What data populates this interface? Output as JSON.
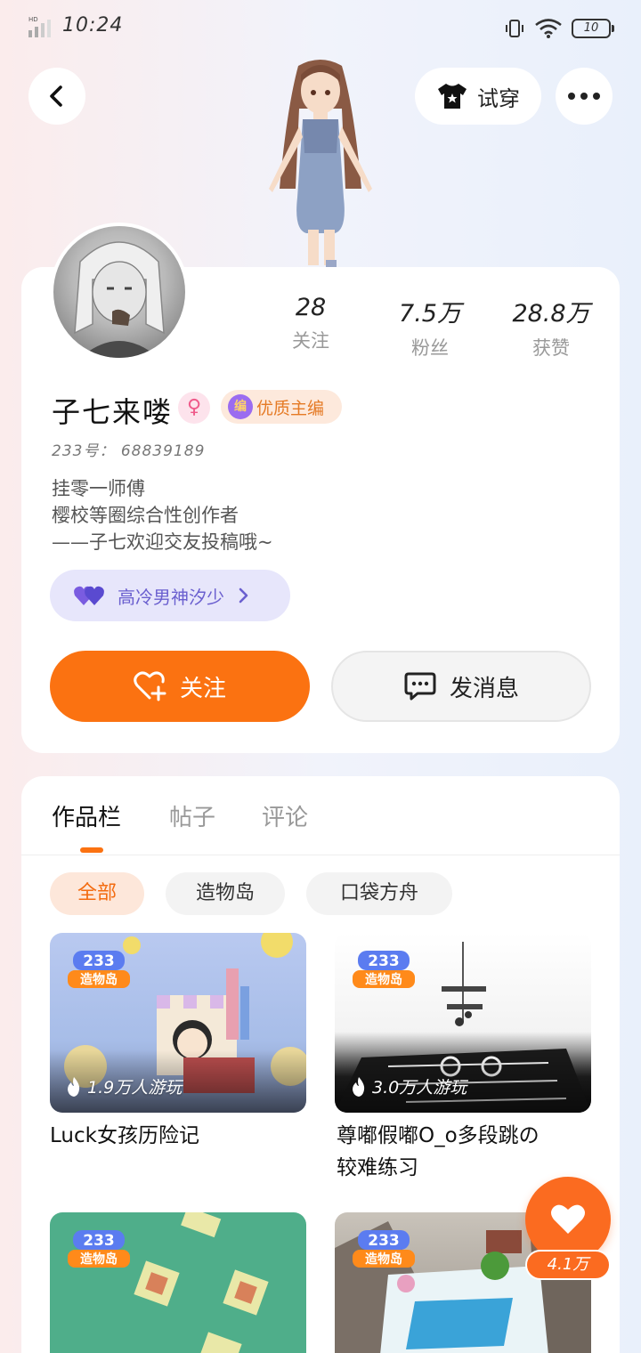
{
  "status_bar": {
    "time": "10:24",
    "battery": "10"
  },
  "top": {
    "tryon_label": "试穿"
  },
  "profile": {
    "name": "子七来喽",
    "editor_badge": "优质主编",
    "editor_badge_icon_text": "编",
    "uid": "233号： 68839189",
    "bio": [
      "挂零一师傅",
      "樱校等圈综合性创作者",
      "——子七欢迎交友投稿哦~"
    ],
    "stats": [
      {
        "num": "28",
        "label": "关注"
      },
      {
        "num": "7.5万",
        "label": "粉丝"
      },
      {
        "num": "28.8万",
        "label": "获赞"
      }
    ],
    "fan_label": "高冷男神汐少",
    "follow_label": "关注",
    "message_label": "发消息"
  },
  "tabs": [
    {
      "label": "作品栏",
      "active": true
    },
    {
      "label": "帖子",
      "active": false
    },
    {
      "label": "评论",
      "active": false
    }
  ],
  "chips": [
    {
      "label": "全部",
      "active": true
    },
    {
      "label": "造物岛",
      "active": false
    },
    {
      "label": "口袋方舟",
      "active": false
    }
  ],
  "logo_text": {
    "top": "233",
    "bottom": "造物岛"
  },
  "works": [
    {
      "plays": "1.9万人游玩",
      "title": "Luck女孩历险记"
    },
    {
      "plays": "3.0万人游玩",
      "title_lines": [
        "尊嘟假嘟O_o多段跳の",
        "较难练习"
      ]
    },
    {
      "plays": "",
      "title": ""
    },
    {
      "plays": "",
      "title": ""
    }
  ],
  "like": {
    "count": "4.1万"
  },
  "colors": {
    "accent": "#fb7211",
    "fan_pill": "#e7e6fb",
    "editor_badge": "#fde9dc"
  }
}
